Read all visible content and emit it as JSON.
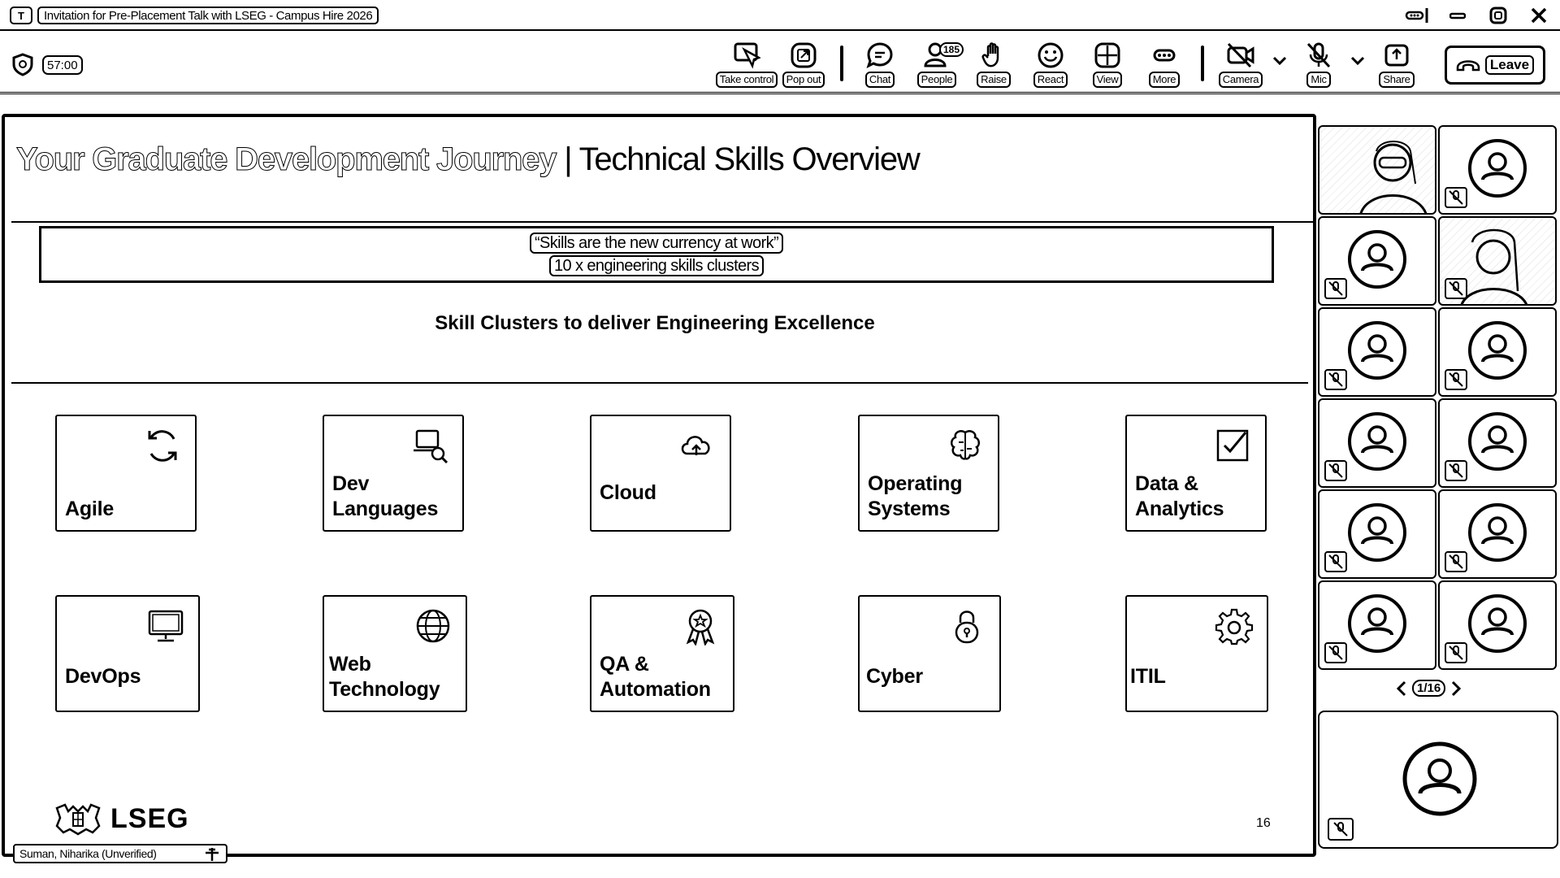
{
  "window": {
    "app_icon": "teams-icon",
    "title": "Invitation for Pre-Placement Talk with LSEG - Campus Hire 2026"
  },
  "toolbar": {
    "timer": "57:00",
    "items": [
      {
        "label": "Take control",
        "icon": "take-control-icon"
      },
      {
        "label": "Pop out",
        "icon": "pop-out-icon"
      },
      {
        "label": "Chat",
        "icon": "chat-icon"
      },
      {
        "label": "People",
        "icon": "people-icon",
        "badge": "185"
      },
      {
        "label": "Raise",
        "icon": "raise-hand-icon"
      },
      {
        "label": "React",
        "icon": "react-icon"
      },
      {
        "label": "View",
        "icon": "view-icon"
      },
      {
        "label": "More",
        "icon": "more-icon"
      },
      {
        "label": "Camera",
        "icon": "camera-off-icon"
      },
      {
        "label": "Mic",
        "icon": "mic-off-icon"
      },
      {
        "label": "Share",
        "icon": "share-icon"
      }
    ],
    "leave_label": "Leave"
  },
  "slide": {
    "title_bold": "Your Graduate Development Journey",
    "title_rest": " | Technical Skills Overview",
    "quote_line1": "“Skills are the new currency at work”",
    "quote_line2": "10 x engineering skills clusters",
    "subheading": "Skill Clusters to deliver Engineering Excellence",
    "cards": [
      {
        "label": "Agile",
        "icon": "refresh-icon"
      },
      {
        "label": "Dev Languages",
        "icon": "laptop-search-icon"
      },
      {
        "label": "Cloud",
        "icon": "cloud-upload-icon"
      },
      {
        "label": "Operating Systems",
        "icon": "brain-icon"
      },
      {
        "label": "Data & Analytics",
        "icon": "checkbox-icon"
      },
      {
        "label": "DevOps",
        "icon": "monitor-icon"
      },
      {
        "label": "Web Technology",
        "icon": "globe-icon"
      },
      {
        "label": "QA & Automation",
        "icon": "award-icon"
      },
      {
        "label": "Cyber",
        "icon": "lock-icon"
      },
      {
        "label": "ITIL",
        "icon": "gear-icon"
      }
    ],
    "logo_text": "LSEG",
    "page_number": "16"
  },
  "presenter": {
    "name": "Suman, Niharika (Unverified)"
  },
  "gallery": {
    "pager": "1/16"
  }
}
